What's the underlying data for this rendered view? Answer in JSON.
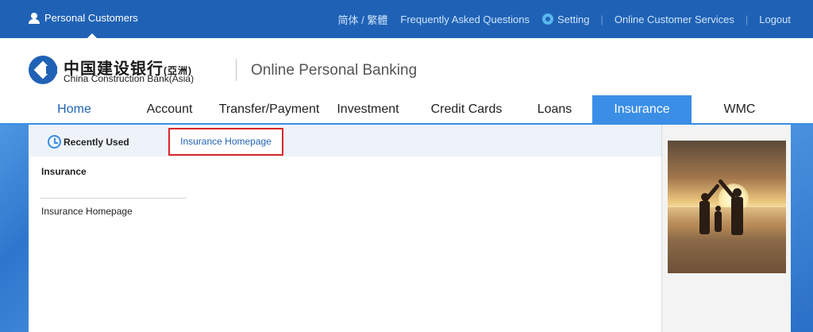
{
  "topbar": {
    "personal_customers": "Personal Customers",
    "language": "简体 / 繁體",
    "faq": "Frequently Asked Questions",
    "setting": "Setting",
    "online_cs": "Online Customer Services",
    "logout": "Logout",
    "separator": "|"
  },
  "brand": {
    "bank_name_cn": "中国建设银行",
    "bank_name_cn_suffix": "(亞洲)",
    "bank_name_en": "China Construction Bank(Asia)",
    "site_title": "Online Personal Banking"
  },
  "nav": {
    "items": [
      {
        "label": "Home"
      },
      {
        "label": "Account"
      },
      {
        "label": "Transfer/Payment"
      },
      {
        "label": "Investment"
      },
      {
        "label": "Credit Cards"
      },
      {
        "label": "Loans"
      },
      {
        "label": "Insurance"
      },
      {
        "label": "WMC"
      }
    ],
    "active": "Insurance"
  },
  "subbar": {
    "recently_used": "Recently Used",
    "insurance_homepage_tab": "Insurance Homepage"
  },
  "sidebar": {
    "title": "Insurance",
    "links": [
      {
        "label": "Insurance Homepage"
      }
    ]
  },
  "colors": {
    "primary_blue": "#1f62b5",
    "active_tab": "#3a8ee6",
    "highlight_border": "#d9252a"
  }
}
